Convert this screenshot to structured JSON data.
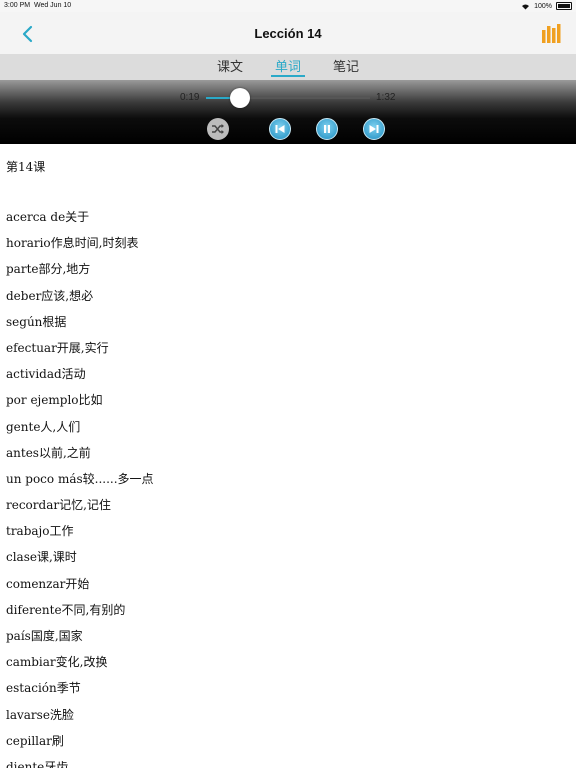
{
  "status": {
    "time": "3:00 PM",
    "date": "Wed Jun 10",
    "battery": "100%"
  },
  "nav": {
    "title": "Lección 14"
  },
  "tabs": [
    {
      "label": "课文",
      "active": false
    },
    {
      "label": "单词",
      "active": true
    },
    {
      "label": "笔记",
      "active": false
    }
  ],
  "player": {
    "current_time": "0:19",
    "total_time": "1:32",
    "progress": 0.21
  },
  "content": {
    "heading": "第14课",
    "items": [
      "acerca de关于",
      "horario作息时间,时刻表",
      "parte部分,地方",
      "deber应该,想必",
      "según根据",
      "efectuar开展,实行",
      "actividad活动",
      "por ejemplo比如",
      "gente人,人们",
      "antes以前,之前",
      "un poco más较......多一点",
      "recordar记忆,记住",
      "trabajo工作",
      "clase课,课时",
      "comenzar开始",
      "diferente不同,有别的",
      "país国度,国家",
      "cambiar变化,改换",
      "estación季节",
      "lavarse洗脸",
      "cepillar刷",
      "diente牙齿"
    ]
  },
  "colors": {
    "accent": "#2aa9c8",
    "orange": "#f0a020"
  },
  "icons": {
    "back": "chevron-left-icon",
    "playlist": "bar-chart-icon",
    "shuffle": "shuffle-icon",
    "prev": "skip-previous-icon",
    "pause": "pause-icon",
    "next": "skip-next-icon"
  }
}
